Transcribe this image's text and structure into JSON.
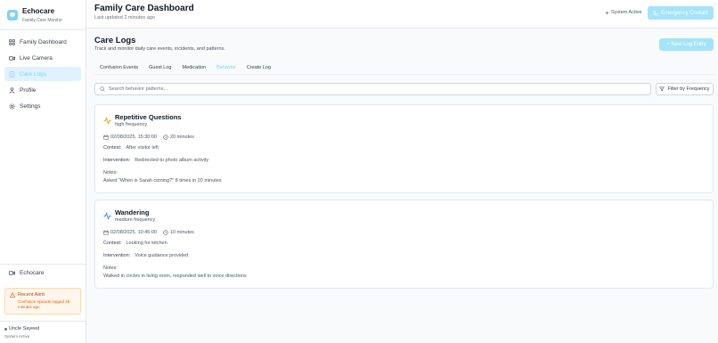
{
  "brand": {
    "name": "Echocare",
    "subtitle": "Family Care Monitor"
  },
  "nav": [
    {
      "label": "Family Dashboard",
      "icon": "grid-icon"
    },
    {
      "label": "Live Camera",
      "icon": "video-icon"
    },
    {
      "label": "Care Logs",
      "icon": "file-icon",
      "active": true
    },
    {
      "label": "Profile",
      "icon": "user-icon"
    },
    {
      "label": "Settings",
      "icon": "gear-icon"
    }
  ],
  "sidebar_bottom": {
    "brand_label": "Echocare",
    "alert_title": "Recent Alert",
    "alert_text": "Confusion episode logged 45 minutes ago",
    "user_name": "Uncle Sayeed",
    "user_status": "System Active"
  },
  "header": {
    "title": "Family Care Dashboard",
    "updated": "Last updated 2 minutes ago",
    "system_status": "System Active",
    "emergency_label": "Emergency Contact"
  },
  "main": {
    "title": "Care Logs",
    "subtitle": "Track and monitor daily care events, incidents, and patterns.",
    "new_log_label": "+ New Log Entry",
    "tabs": [
      {
        "label": "Confusion Events"
      },
      {
        "label": "Guest Log"
      },
      {
        "label": "Medication"
      },
      {
        "label": "Behavior",
        "active": true
      },
      {
        "label": "Create Log"
      }
    ],
    "search_placeholder": "Search behavior patterns...",
    "filter_label": "Filter by Frequency"
  },
  "cards": [
    {
      "title": "Repetitive Questions",
      "frequency": "high frequency",
      "date": "02/08/2025, 15:30:00",
      "duration": "20 minutes",
      "context_label": "Context:",
      "context": "After visitor left",
      "intervention_label": "Intervention:",
      "intervention": "Redirected to photo album activity",
      "notes_label": "Notes:",
      "notes": "Asked \"When is Sarah coming?\" 8 times in 20 minutes",
      "icon_color": "#f59e0b"
    },
    {
      "title": "Wandering",
      "frequency": "medium frequency",
      "date": "02/08/2025, 10:45:00",
      "duration": "10 minutes",
      "context_label": "Context:",
      "context": "Looking for kitchen",
      "intervention_label": "Intervention:",
      "intervention": "Voice guidance provided",
      "notes_label": "Notes:",
      "notes": "Walked in circles in living room, responded well to voice directions",
      "icon_color": "#3b82f6"
    }
  ]
}
